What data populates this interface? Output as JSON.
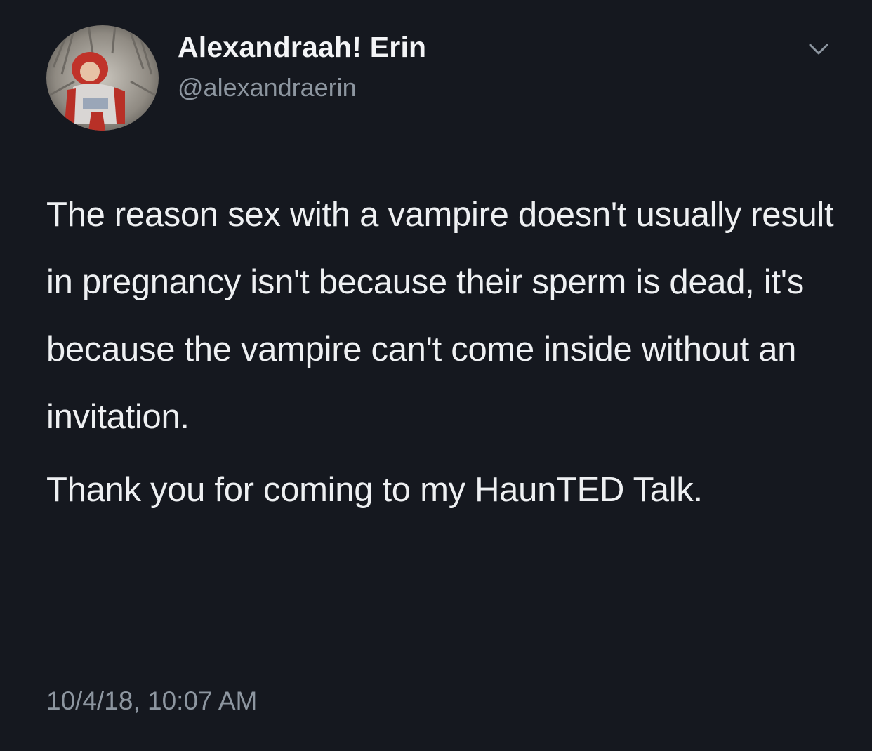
{
  "tweet": {
    "author": {
      "display_name": "Alexandraah! Erin",
      "handle": "@alexandraerin"
    },
    "menu_icon": "chevron-down-icon",
    "text_paragraphs": [
      "The reason sex with a vampire doesn't usually result in pregnancy isn't because their sperm is dead, it's because the vampire can't come inside without an invitation.",
      "Thank you for coming to my HaunTED Talk."
    ],
    "timestamp": "10/4/18, 10:07 AM"
  },
  "colors": {
    "background": "#15181f",
    "primary_text": "#eef0f2",
    "secondary_text": "#8d96a0"
  }
}
